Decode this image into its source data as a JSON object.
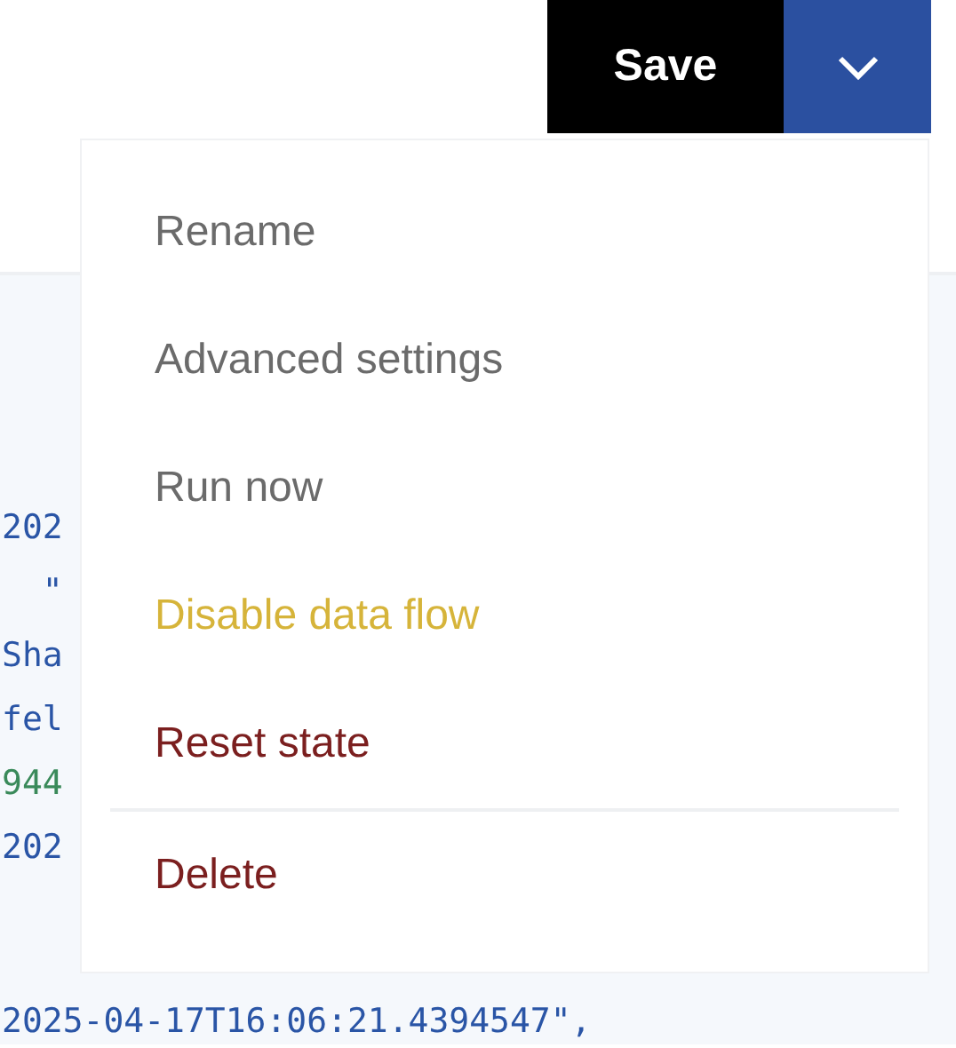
{
  "toolbar": {
    "save_label": "Save"
  },
  "code_blocks": [
    [
      {
        "text": "202",
        "kind": "string"
      },
      {
        "text": "  \"",
        "kind": "string"
      },
      {
        "text": "Sha",
        "kind": "string"
      },
      {
        "text": "fel",
        "kind": "string"
      },
      {
        "text": "944",
        "kind": "number"
      },
      {
        "text": "202",
        "kind": "string"
      }
    ],
    [
      {
        "text": "2025-04-17T16:06:21.4394547\",",
        "kind": "string"
      }
    ]
  ],
  "menu": {
    "sections": [
      [
        {
          "label": "Rename",
          "kind": "normal"
        },
        {
          "label": "Advanced settings",
          "kind": "normal"
        },
        {
          "label": "Run now",
          "kind": "normal"
        },
        {
          "label": "Disable data flow",
          "kind": "warning"
        },
        {
          "label": "Reset state",
          "kind": "danger"
        }
      ],
      [
        {
          "label": "Delete",
          "kind": "danger"
        }
      ]
    ]
  }
}
